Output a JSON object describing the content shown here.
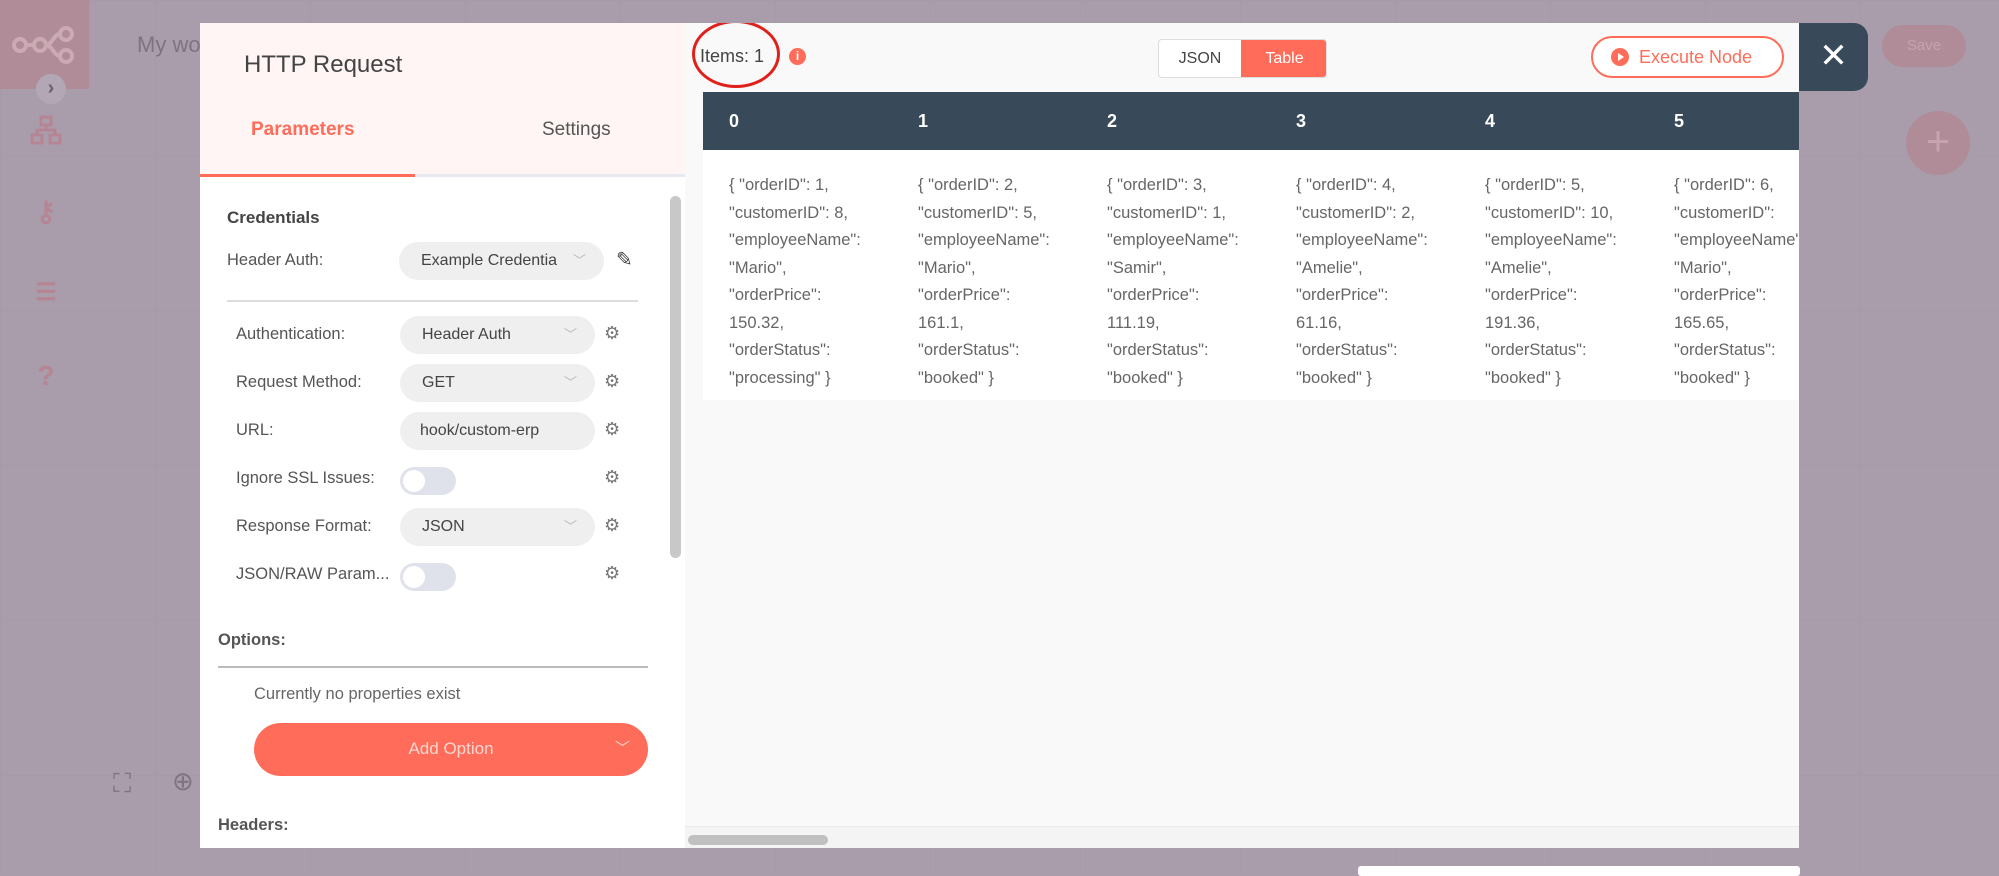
{
  "colors": {
    "accent": "#ff6d5a",
    "header_dark": "#384a59",
    "overlay": "#a99dab"
  },
  "sidebar": {
    "icons": [
      "n8n-logo-icon",
      "chevron-right-icon",
      "network-icon",
      "key-icon",
      "checklist-icon",
      "help-icon"
    ]
  },
  "workflow": {
    "title": "My wo",
    "save_label": "Save"
  },
  "node": {
    "title": "HTTP Request",
    "tabs": [
      {
        "label": "Parameters",
        "active": true
      },
      {
        "label": "Settings",
        "active": false
      }
    ]
  },
  "params": {
    "credentials_heading": "Credentials",
    "header_auth_label": "Header Auth:",
    "header_auth_value": "Example Credentia",
    "authentication_label": "Authentication:",
    "authentication_value": "Header Auth",
    "method_label": "Request Method:",
    "method_value": "GET",
    "url_label": "URL:",
    "url_value": "hook/custom-erp",
    "ssl_label": "Ignore SSL Issues:",
    "ssl_on": false,
    "format_label": "Response Format:",
    "format_value": "JSON",
    "raw_label": "JSON/RAW Param...",
    "raw_on": false,
    "options_heading": "Options:",
    "options_empty": "Currently no properties exist",
    "add_option": "Add Option",
    "headers_heading": "Headers:"
  },
  "output": {
    "items_label": "Items: 1",
    "view_json": "JSON",
    "view_table": "Table",
    "active_view": "Table",
    "execute_label": "Execute Node",
    "columns": [
      "0",
      "1",
      "2",
      "3",
      "4",
      "5"
    ],
    "cells": [
      [
        "{ \"orderID\": 1,",
        "\"customerID\": 8,",
        "\"employeeName\":",
        "\"Mario\",",
        "\"orderPrice\":",
        "150.32,",
        "\"orderStatus\":",
        "\"processing\" }"
      ],
      [
        "{ \"orderID\": 2,",
        "\"customerID\": 5,",
        "\"employeeName\":",
        "\"Mario\",",
        "\"orderPrice\":",
        "161.1,",
        "\"orderStatus\":",
        "\"booked\" }"
      ],
      [
        "{ \"orderID\": 3,",
        "\"customerID\": 1,",
        "\"employeeName\":",
        "\"Samir\",",
        "\"orderPrice\":",
        "111.19,",
        "\"orderStatus\":",
        "\"booked\" }"
      ],
      [
        "{ \"orderID\": 4,",
        "\"customerID\": 2,",
        "\"employeeName\":",
        "\"Amelie\",",
        "\"orderPrice\":",
        "61.16,",
        "\"orderStatus\":",
        "\"booked\" }"
      ],
      [
        "{ \"orderID\": 5,",
        "\"customerID\": 10,",
        "\"employeeName\":",
        "\"Amelie\",",
        "\"orderPrice\":",
        "191.36,",
        "\"orderStatus\":",
        "\"booked\" }"
      ],
      [
        "{ \"orderID\": 6,",
        "\"customerID\":",
        "\"employeeName\":",
        "\"Mario\",",
        "\"orderPrice\":",
        "165.65,",
        "\"orderStatus\":",
        "\"booked\" }"
      ]
    ]
  }
}
